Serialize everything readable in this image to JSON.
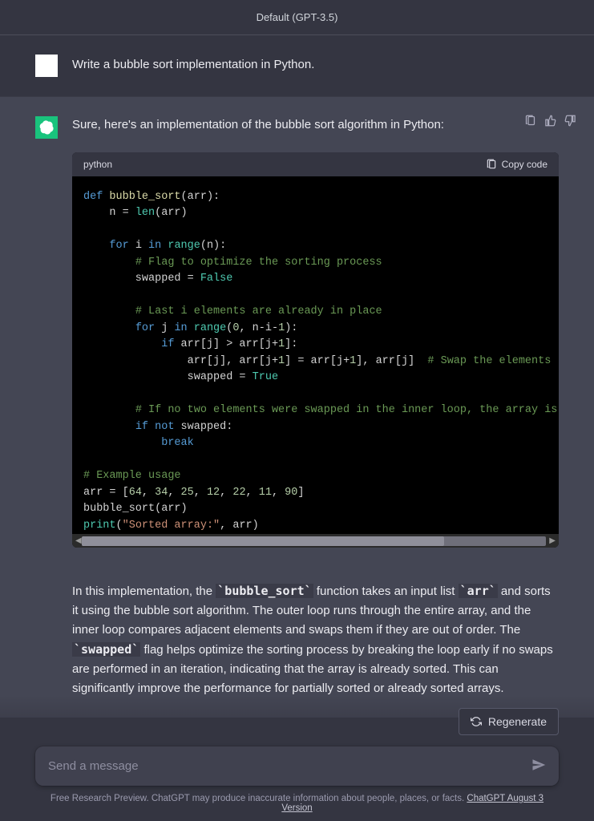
{
  "header": {
    "model": "Default (GPT-3.5)"
  },
  "user": {
    "prompt": "Write a bubble sort implementation in Python."
  },
  "assistant": {
    "intro": "Sure, here's an implementation of the bubble sort algorithm in Python:",
    "code": {
      "language": "python",
      "copy_label": "Copy code"
    },
    "explain_parts": {
      "p1": "In this implementation, the ",
      "c1": "`bubble_sort`",
      "p2": " function takes an input list ",
      "c2": "`arr`",
      "p3": " and sorts it using the bubble sort algorithm. The outer loop runs through the entire array, and the inner loop compares adjacent elements and swaps them if they are out of order. The ",
      "c3": "`swapped`",
      "p4": " flag helps optimize the sorting process by breaking the loop early if no swaps are performed in an iteration, indicating that the array is already sorted. This can significantly improve the performance for partially sorted or already sorted arrays."
    }
  },
  "footer": {
    "regenerate": "Regenerate",
    "placeholder": "Send a message",
    "disclaimer": "Free Research Preview. ChatGPT may produce inaccurate information about people, places, or facts. ",
    "version_link": "ChatGPT August 3 Version"
  }
}
